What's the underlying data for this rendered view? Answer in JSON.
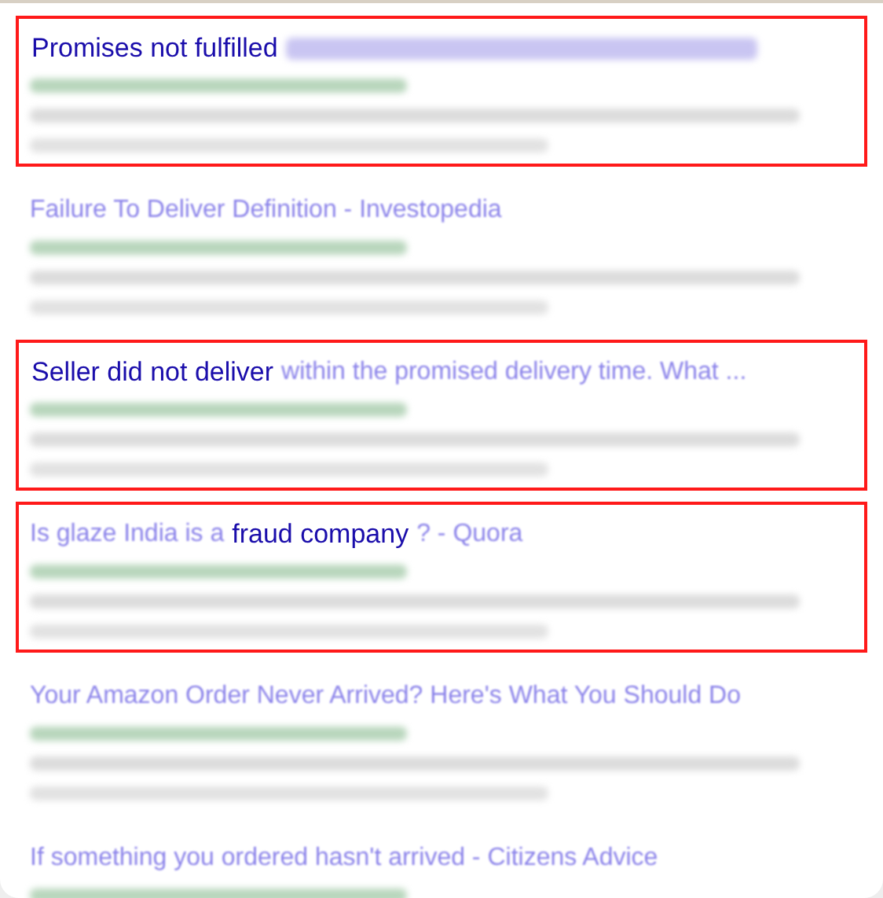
{
  "results": [
    {
      "highlighted": true,
      "title": [
        {
          "text": "Promises not fulfilled",
          "sharp": true
        },
        {
          "sharp": false
        }
      ]
    },
    {
      "highlighted": false,
      "title": [
        {
          "text": "Failure To Deliver Definition - Investopedia",
          "sharp": false
        }
      ]
    },
    {
      "highlighted": true,
      "title": [
        {
          "text": "Seller did not deliver",
          "sharp": true
        },
        {
          "text": "within the promised delivery time. What ...",
          "sharp": false
        }
      ]
    },
    {
      "highlighted": true,
      "title": [
        {
          "text": "Is glaze India is a",
          "sharp": false
        },
        {
          "text": "fraud company",
          "sharp": true
        },
        {
          "text": "? - Quora",
          "sharp": false
        }
      ]
    },
    {
      "highlighted": false,
      "title": [
        {
          "text": "Your Amazon Order Never Arrived? Here's What You Should Do",
          "sharp": false
        }
      ]
    },
    {
      "highlighted": false,
      "title": [
        {
          "text": "If something you ordered hasn't arrived - Citizens Advice",
          "sharp": false
        }
      ]
    }
  ]
}
